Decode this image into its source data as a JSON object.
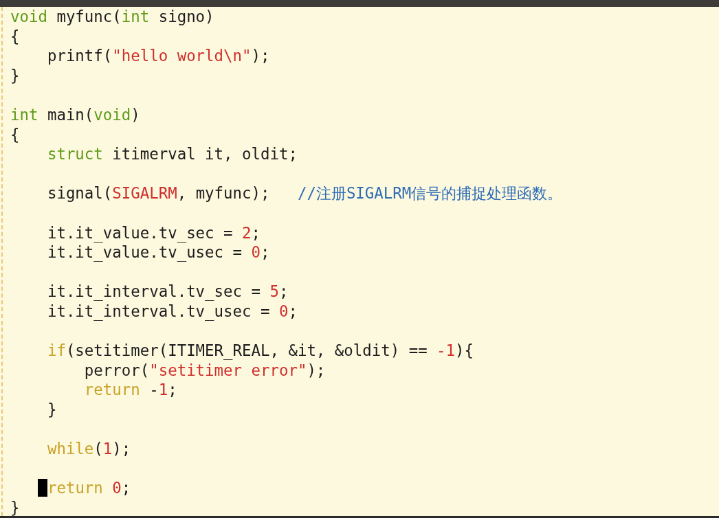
{
  "editor": {
    "blocks": [
      {
        "lines": [
          {
            "tokens": [
              {
                "text": "void",
                "kind": "type"
              },
              {
                "text": " myfunc("
              },
              {
                "text": "int",
                "kind": "type"
              },
              {
                "text": " signo)"
              }
            ]
          },
          {
            "tokens": [
              {
                "text": "{"
              }
            ]
          },
          {
            "tokens": [
              {
                "text": "    printf("
              },
              {
                "text": "\"hello world",
                "kind": "string"
              },
              {
                "text": "\\n",
                "kind": "special"
              },
              {
                "text": "\"",
                "kind": "string"
              },
              {
                "text": ");"
              }
            ]
          },
          {
            "tokens": [
              {
                "text": "}"
              }
            ]
          }
        ]
      },
      {
        "lines": [
          {
            "tokens": [
              {
                "text": "int",
                "kind": "type"
              },
              {
                "text": " main("
              },
              {
                "text": "void",
                "kind": "type"
              },
              {
                "text": ")"
              }
            ]
          },
          {
            "tokens": [
              {
                "text": "{"
              }
            ]
          },
          {
            "tokens": [
              {
                "text": "    struct",
                "kind": "type"
              },
              {
                "text": " itimerval it, oldit;"
              }
            ]
          }
        ]
      },
      {
        "lines": [
          {
            "tokens": [
              {
                "text": "    signal("
              },
              {
                "text": "SIGALRM",
                "kind": "constant"
              },
              {
                "text": ", myfunc);   "
              },
              {
                "text": "//注册SIGALRM信号的捕捉处理函数。",
                "kind": "comment"
              }
            ]
          }
        ]
      },
      {
        "lines": [
          {
            "tokens": [
              {
                "text": "    it.it_value.tv_sec = "
              },
              {
                "text": "2",
                "kind": "number"
              },
              {
                "text": ";"
              }
            ]
          },
          {
            "tokens": [
              {
                "text": "    it.it_value.tv_usec = "
              },
              {
                "text": "0",
                "kind": "number"
              },
              {
                "text": ";"
              }
            ]
          }
        ]
      },
      {
        "lines": [
          {
            "tokens": [
              {
                "text": "    it.it_interval.tv_sec = "
              },
              {
                "text": "5",
                "kind": "number"
              },
              {
                "text": ";"
              }
            ]
          },
          {
            "tokens": [
              {
                "text": "    it.it_interval.tv_usec = "
              },
              {
                "text": "0",
                "kind": "number"
              },
              {
                "text": ";"
              }
            ]
          }
        ]
      },
      {
        "lines": [
          {
            "tokens": [
              {
                "text": "    if",
                "kind": "keyword"
              },
              {
                "text": "(setitimer(ITIMER_REAL, &it, &oldit) == "
              },
              {
                "text": "-1",
                "kind": "number"
              },
              {
                "text": "){"
              }
            ]
          },
          {
            "tokens": [
              {
                "text": "        perror("
              },
              {
                "text": "\"setitimer error\"",
                "kind": "string"
              },
              {
                "text": ");"
              }
            ]
          },
          {
            "tokens": [
              {
                "text": "        return",
                "kind": "keyword"
              },
              {
                "text": " -"
              },
              {
                "text": "1",
                "kind": "number"
              },
              {
                "text": ";"
              }
            ]
          },
          {
            "tokens": [
              {
                "text": "    }"
              }
            ]
          }
        ]
      },
      {
        "lines": [
          {
            "tokens": [
              {
                "text": "    while",
                "kind": "keyword"
              },
              {
                "text": "("
              },
              {
                "text": "1",
                "kind": "number"
              },
              {
                "text": ");"
              }
            ]
          }
        ]
      },
      {
        "lines": [
          {
            "cursor": true,
            "tokens": [
              {
                "text": "    return",
                "kind": "keyword"
              },
              {
                "text": " 0",
                "kind": "number"
              },
              {
                "text": ";"
              }
            ]
          },
          {
            "tokens": [
              {
                "text": "}"
              }
            ]
          }
        ]
      }
    ]
  }
}
